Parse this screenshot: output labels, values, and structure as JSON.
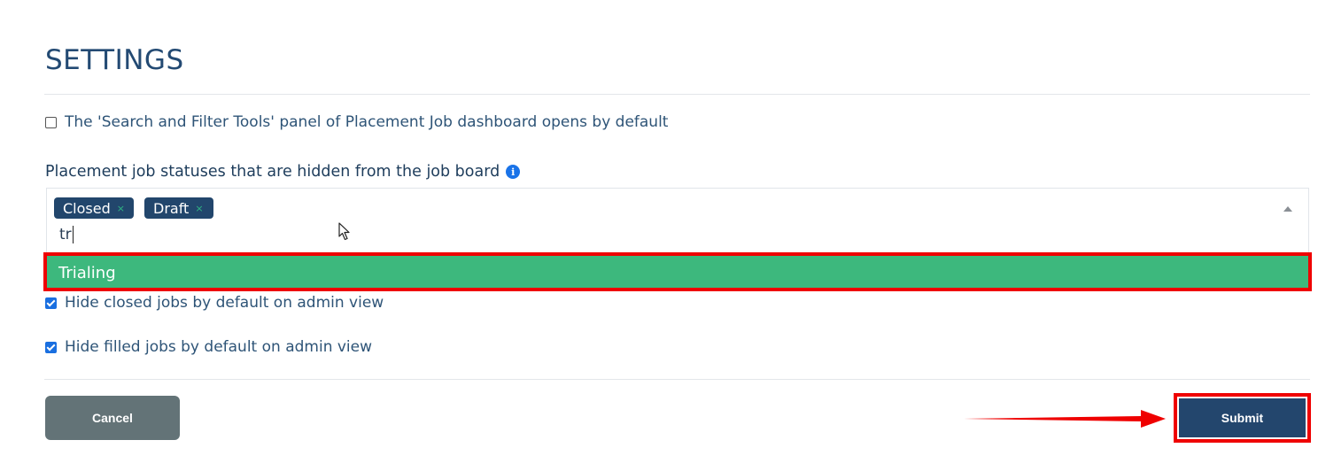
{
  "page": {
    "title": "SETTINGS"
  },
  "options": {
    "search_panel_default": {
      "label": "The 'Search and Filter Tools' panel of Placement Job dashboard opens by default",
      "checked": false
    },
    "hidden_statuses": {
      "label": "Placement job statuses that are hidden from the job board",
      "info_icon": "info-icon",
      "selected": [
        {
          "label": "Closed",
          "remove": "×"
        },
        {
          "label": "Draft",
          "remove": "×"
        }
      ],
      "search_value": "tr",
      "highlighted_option": "Trialing"
    },
    "hide_closed": {
      "label": "Hide closed jobs by default on admin view",
      "checked": true
    },
    "hide_filled": {
      "label": "Hide filled jobs by default on admin view",
      "checked": true
    }
  },
  "actions": {
    "cancel_label": "Cancel",
    "submit_label": "Submit"
  },
  "colors": {
    "primary": "#23466d",
    "highlight_option": "#3db87d",
    "annotation_red": "#ef0000",
    "cancel": "#637377",
    "checkbox_checked": "#1a6fe0"
  }
}
